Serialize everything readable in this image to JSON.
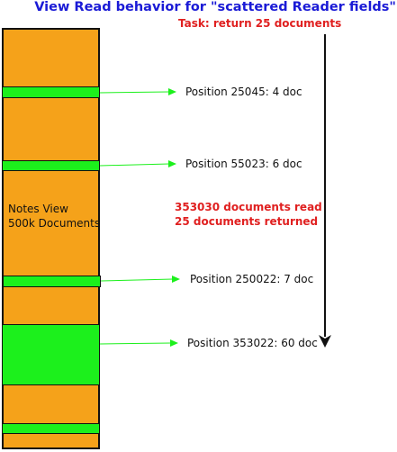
{
  "title": "View Read behavior for \"scattered Reader fields\"",
  "task": "Task: return 25 documents",
  "view": {
    "line1": "Notes View",
    "line2": "500k Documents"
  },
  "positions": [
    {
      "label": "Position 25045: 4 doc"
    },
    {
      "label": "Position 55023: 6 doc"
    },
    {
      "label": "Position 250022: 7 doc"
    },
    {
      "label": "Position 353022: 60 doc"
    }
  ],
  "summary": {
    "line1": "353030 documents read",
    "line2": "25 documents returned"
  },
  "colors": {
    "view": "#f5a21a",
    "match": "#1cf01c",
    "title": "#1a1ad6",
    "highlight": "#e02020",
    "arrow": "#1cf01c"
  }
}
